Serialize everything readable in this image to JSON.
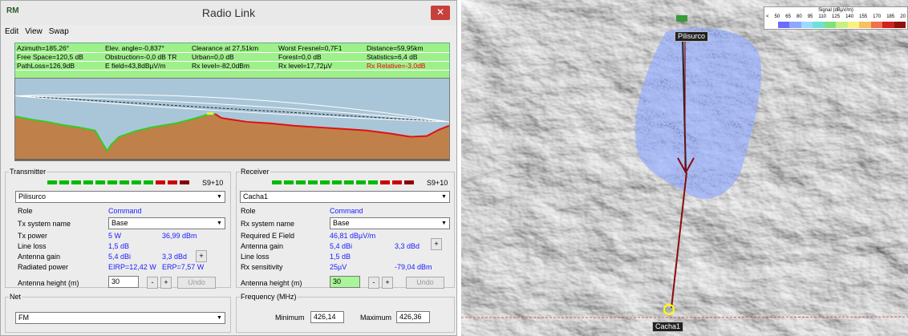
{
  "window": {
    "title": "Radio Link",
    "app_icon": "RM",
    "close_glyph": "✕"
  },
  "menu": [
    "Edit",
    "View",
    "Swap"
  ],
  "stats": [
    [
      "Azimuth=185,26°",
      "Elev. angle=-0,837°",
      "Clearance at 27,51km",
      "Worst Fresnel=0,7F1",
      "Distance=59,95km"
    ],
    [
      "Free Space=120,5 dB",
      "Obstruction=-0,0 dB TR",
      "Urban=0,0 dB",
      "Forest=0,0 dB",
      "Statistics=6,4 dB"
    ],
    [
      "PathLoss=126,9dB",
      "E field=43,8dBµV/m",
      "Rx level=-82,0dBm",
      "Rx level=17,72µV",
      "Rx Relative=-3,0dB"
    ]
  ],
  "transmitter": {
    "legend": "Transmitter",
    "meter_label": "S9+10",
    "site": "Pilisurco",
    "role_label": "Role",
    "role_value": "Command",
    "system_label": "Tx system name",
    "system_value": "Base",
    "power_label": "Tx power",
    "power_w": "5 W",
    "power_dbm": "36,99 dBm",
    "line_loss_label": "Line loss",
    "line_loss": "1,5 dB",
    "gain_label": "Antenna gain",
    "gain_dbi": "5,4 dBi",
    "gain_dbd": "3,3 dBd",
    "gain_btn": "+",
    "radiated_label": "Radiated power",
    "eirp": "EIRP=12,42 W",
    "erp": "ERP=7,57 W",
    "height_label": "Antenna height (m)",
    "height_value": "30",
    "minus": "-",
    "plus": "+",
    "undo": "Undo"
  },
  "receiver": {
    "legend": "Receiver",
    "meter_label": "S9+10",
    "site": "Cacha1",
    "role_label": "Role",
    "role_value": "Command",
    "system_label": "Rx system name",
    "system_value": "Base",
    "efield_label": "Required E Field",
    "efield_value": "46,81 dBµV/m",
    "gain_label": "Antenna gain",
    "gain_dbi": "5,4 dBi",
    "gain_dbd": "3,3 dBd",
    "gain_btn": "+",
    "line_loss_label": "Line loss",
    "line_loss": "1,5 dB",
    "sens_label": "Rx sensitivity",
    "sens_uv": "25µV",
    "sens_dbm": "-79,04 dBm",
    "height_label": "Antenna height (m)",
    "height_value": "30",
    "minus": "-",
    "plus": "+",
    "undo": "Undo"
  },
  "net": {
    "legend": "Net",
    "value": "FM"
  },
  "frequency": {
    "legend": "Frequency (MHz)",
    "min_label": "Minimum",
    "min_value": "426,14",
    "max_label": "Maximum",
    "max_value": "426,36"
  },
  "map": {
    "legend_title": "Signal (dBµV/m)",
    "legend_ticks": [
      "<",
      "50",
      "65",
      "80",
      "95",
      "110",
      "125",
      "140",
      "155",
      "170",
      "185",
      "20"
    ],
    "legend_colors": [
      "#ffffff",
      "#6b6bff",
      "#8fa8ff",
      "#9fd8ff",
      "#6fe0d8",
      "#80e080",
      "#c8f080",
      "#f8f080",
      "#f8c060",
      "#f07050",
      "#d02020",
      "#901010"
    ],
    "site_tx": "Pilisurco",
    "site_rx": "Cacha1"
  }
}
